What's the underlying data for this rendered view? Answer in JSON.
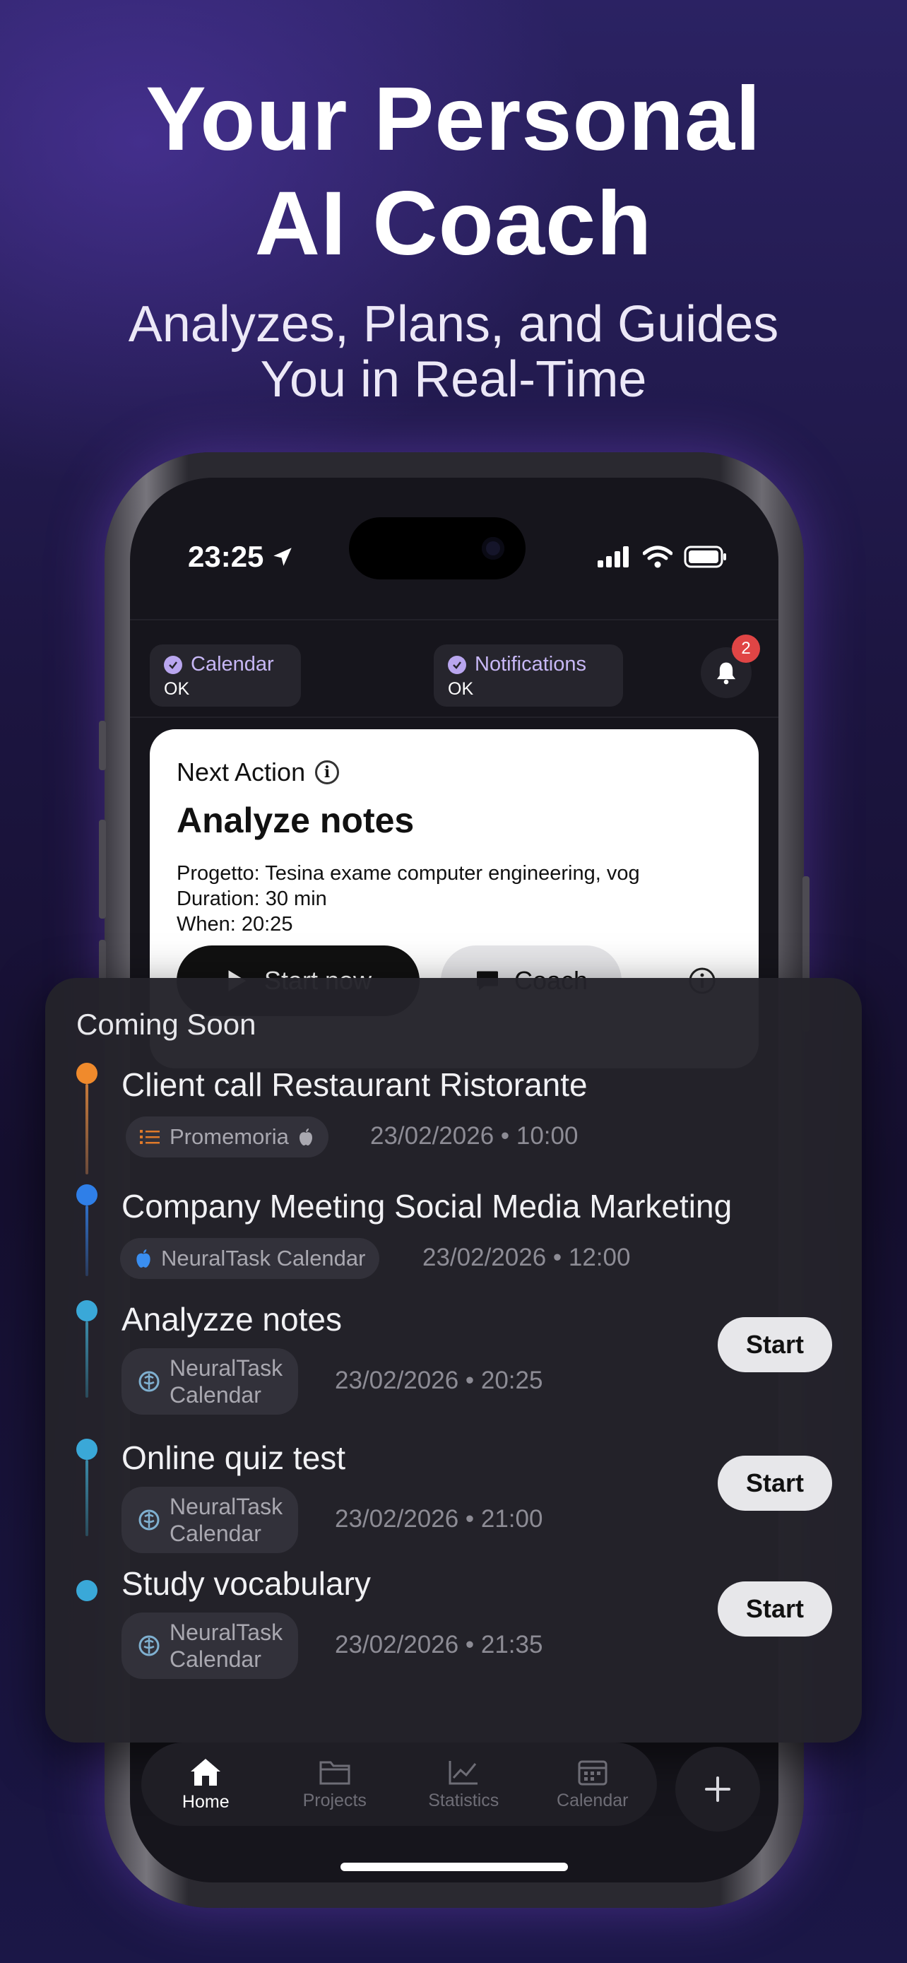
{
  "headline": {
    "line1": "Your Personal",
    "line2": "AI Coach"
  },
  "subheadline": {
    "line1": "Analyzes, Plans, and Guides",
    "line2": "You in Real-Time"
  },
  "status_bar": {
    "time": "23:25"
  },
  "chips": [
    {
      "label": "Calendar",
      "status": "OK"
    },
    {
      "label": "Notifications",
      "status": "OK"
    }
  ],
  "notifications": {
    "badge_count": "2"
  },
  "next_action": {
    "label": "Next Action",
    "title": "Analyze notes",
    "details": {
      "project": "Progetto: Tesina exame computer engineering, vog",
      "duration": "Duration: 30 min",
      "when": "When: 20:25"
    },
    "start_label": "Start now",
    "coach_label": "Coach"
  },
  "coming_soon": {
    "title": "Coming Soon",
    "items": [
      {
        "title": "Client call Restaurant Ristorante",
        "tag": "Promemoria",
        "datetime": "23/02/2026 • 10:00",
        "dot_color": "#f08a2c"
      },
      {
        "title": "Company Meeting Social Media Marketing",
        "tag": "NeuralTask Calendar",
        "datetime": "23/02/2026 • 12:00",
        "dot_color": "#2f7fe8"
      },
      {
        "title": "Analyzze notes",
        "tag": "NeuralTask\nCalendar",
        "datetime": "23/02/2026 • 20:25",
        "dot_color": "#3aa8d8",
        "action": "Start"
      },
      {
        "title": "Online quiz test",
        "tag": "NeuralTask\nCalendar",
        "datetime": "23/02/2026 • 21:00",
        "dot_color": "#3aa8d8",
        "action": "Start"
      },
      {
        "title": "Study vocabulary",
        "tag": "NeuralTask\nCalendar",
        "datetime": "23/02/2026 • 21:35",
        "dot_color": "#3aa8d8",
        "action": "Start"
      }
    ]
  },
  "tabbar": {
    "tabs": [
      {
        "label": "Home",
        "icon": "home-icon",
        "active": true
      },
      {
        "label": "Projects",
        "icon": "folder-icon",
        "active": false
      },
      {
        "label": "Statistics",
        "icon": "chart-icon",
        "active": false
      },
      {
        "label": "Calendar",
        "icon": "calendar-icon",
        "active": false
      }
    ],
    "add_icon": "plus-icon"
  },
  "colors": {
    "background": "#1c1540",
    "accent_purple": "#c7b7f5",
    "badge_red": "#e04545",
    "orange_dot": "#f08a2c",
    "blue_dot": "#2f7fe8",
    "cyan_dot": "#3aa8d8"
  }
}
